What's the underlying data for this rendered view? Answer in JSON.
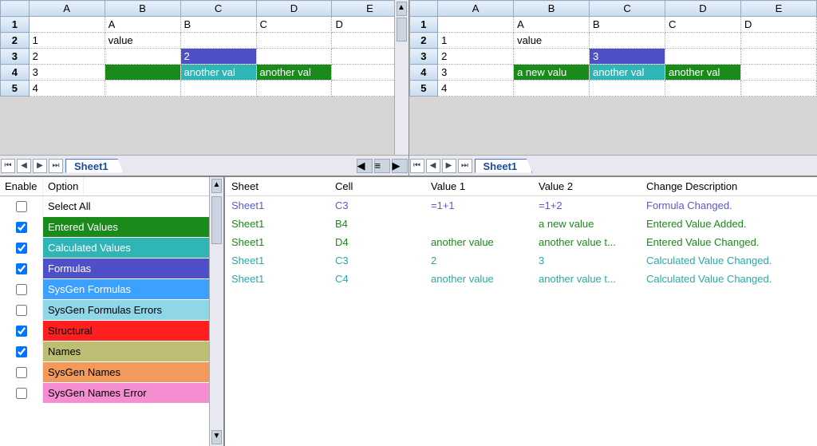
{
  "columns": [
    "A",
    "B",
    "C",
    "D",
    "E"
  ],
  "rows": [
    "1",
    "2",
    "3",
    "4",
    "5"
  ],
  "left_sheet": {
    "tab": "Sheet1",
    "cells": {
      "B1": "A",
      "C1": "B",
      "D1": "C",
      "E1": "D",
      "A2": "1",
      "B2": "value",
      "A3": "2",
      "C3": "2",
      "A4": "3",
      "C4": "another val",
      "D4": "another val",
      "A5": "4"
    }
  },
  "right_sheet": {
    "tab": "Sheet1",
    "cells": {
      "B1": "A",
      "C1": "B",
      "D1": "C",
      "E1": "D",
      "A2": "1",
      "B2": "value",
      "A3": "2",
      "C3": "3",
      "A4": "3",
      "B4": "a new valu",
      "C4": "another val",
      "D4": "another val",
      "A5": "4"
    }
  },
  "options_header": {
    "enable": "Enable",
    "option": "Option"
  },
  "options": [
    {
      "checked": false,
      "label": "Select All",
      "bg": "#ffffff",
      "fg": "#000"
    },
    {
      "checked": true,
      "label": "Entered Values",
      "bg": "#1a8a1a",
      "fg": "#fff"
    },
    {
      "checked": true,
      "label": "Calculated Values",
      "bg": "#2fb5b5",
      "fg": "#fff"
    },
    {
      "checked": true,
      "label": "Formulas",
      "bg": "#4f4fc7",
      "fg": "#fff"
    },
    {
      "checked": false,
      "label": "SysGen Formulas",
      "bg": "#3ba0ff",
      "fg": "#fff"
    },
    {
      "checked": false,
      "label": "SysGen Formulas Errors",
      "bg": "#8fd6e6",
      "fg": "#000"
    },
    {
      "checked": true,
      "label": "Structural",
      "bg": "#ff1f1f",
      "fg": "#000"
    },
    {
      "checked": true,
      "label": "Names",
      "bg": "#bdbd74",
      "fg": "#000"
    },
    {
      "checked": false,
      "label": "SysGen Names",
      "bg": "#f29a5c",
      "fg": "#000"
    },
    {
      "checked": false,
      "label": "SysGen Names Error",
      "bg": "#f58ed1",
      "fg": "#000"
    }
  ],
  "diff_header": {
    "sheet": "Sheet",
    "cell": "Cell",
    "v1": "Value 1",
    "v2": "Value 2",
    "desc": "Change Description"
  },
  "diffs": [
    {
      "sheet": "Sheet1",
      "cell": "C3",
      "v1": "=1+1",
      "v2": "=1+2",
      "desc": "Formula Changed.",
      "cls": "t-formula"
    },
    {
      "sheet": "Sheet1",
      "cell": "B4",
      "v1": "",
      "v2": "a new value",
      "desc": "Entered Value Added.",
      "cls": "t-green"
    },
    {
      "sheet": "Sheet1",
      "cell": "D4",
      "v1": "another value",
      "v2": "another value t...",
      "desc": "Entered Value Changed.",
      "cls": "t-green"
    },
    {
      "sheet": "Sheet1",
      "cell": "C3",
      "v1": "2",
      "v2": "3",
      "desc": "Calculated Value Changed.",
      "cls": "t-teal"
    },
    {
      "sheet": "Sheet1",
      "cell": "C4",
      "v1": "another value",
      "v2": "another value t...",
      "desc": "Calculated Value Changed.",
      "cls": "t-teal"
    }
  ],
  "left_highlights": {
    "C3": "c-formula",
    "B4": "c-green",
    "C4": "c-teal",
    "D4": "c-green"
  },
  "right_highlights": {
    "C3": "c-formula",
    "B4": "c-green",
    "C4": "c-teal",
    "D4": "c-green"
  }
}
